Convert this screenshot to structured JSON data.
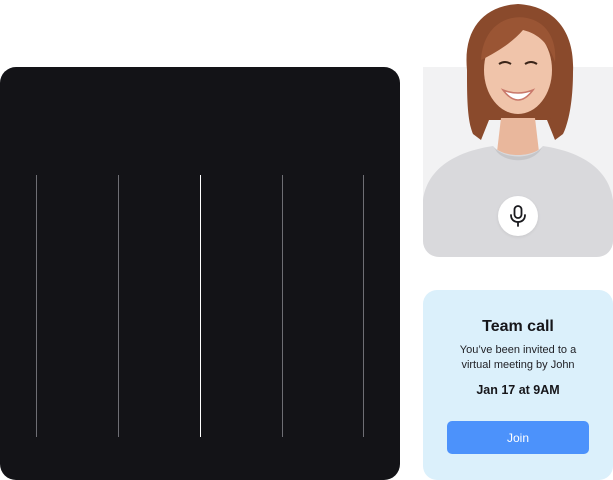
{
  "video_panel": {
    "background": "#131317"
  },
  "participant": {
    "photo": "smiling-woman-photo",
    "mic_icon": "microphone-icon"
  },
  "invite": {
    "title": "Team call",
    "message": "You’ve been invited to a virtual meeting by John",
    "time": "Jan 17 at 9AM",
    "join_label": "Join",
    "background": "#dbf0fb",
    "button_color": "#4c92fb"
  }
}
